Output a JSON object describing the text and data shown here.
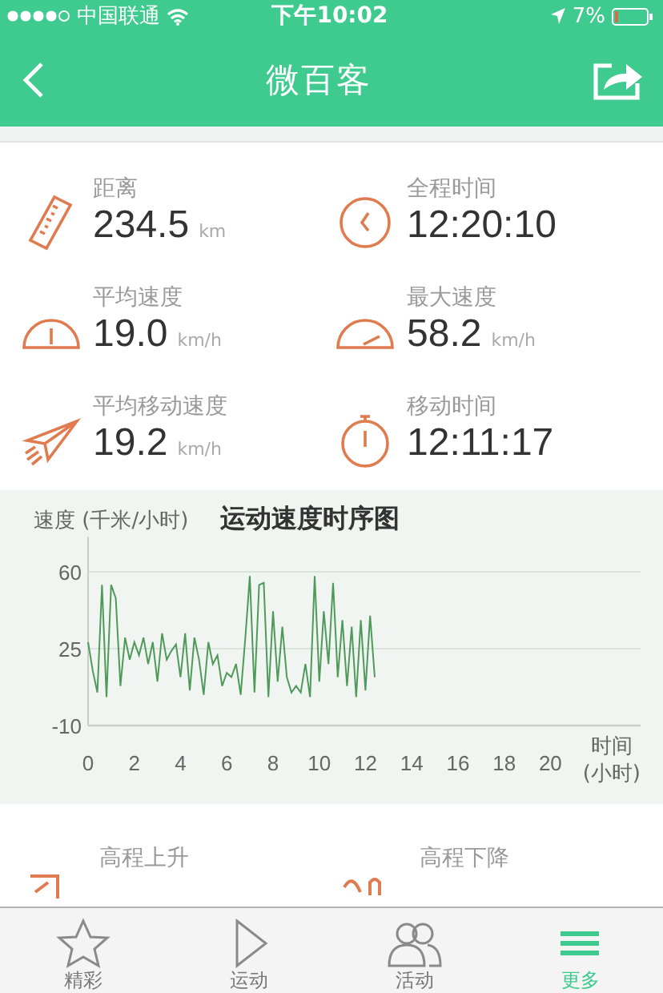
{
  "status_bar": {
    "carrier": "中国联通",
    "time": "下午10:02",
    "battery": "7%"
  },
  "nav": {
    "title": "微百客"
  },
  "stats": [
    {
      "kind": "ruler",
      "label": "距离",
      "value": "234.5",
      "unit": "km"
    },
    {
      "kind": "clock",
      "label": "全程时间",
      "value": "12:20:10"
    },
    {
      "kind": "gauge",
      "label": "平均速度",
      "value": "19.0",
      "unit": "km/h"
    },
    {
      "kind": "gauge-high",
      "label": "最大速度",
      "value": "58.2",
      "unit": "km/h"
    },
    {
      "kind": "plane",
      "label": "平均移动速度",
      "value": "19.2",
      "unit": "km/h"
    },
    {
      "kind": "stopwatch",
      "label": "移动时间",
      "value": "12:11:17"
    }
  ],
  "speed_chart": {
    "chart_data": {
      "type": "line",
      "title": "运动速度时序图",
      "ylabel": "速度 (千米/小时)",
      "xlabel": "时间\n(小时)",
      "xlim": [
        0,
        23.9
      ],
      "ylim": [
        -10,
        60
      ],
      "xticks": [
        0,
        2,
        4,
        6,
        8,
        10,
        12,
        14,
        16,
        18,
        20
      ],
      "yticks": [
        -10,
        25,
        60
      ],
      "x": [
        0,
        0.2,
        0.4,
        0.6,
        0.8,
        1,
        1.2,
        1.4,
        1.6,
        1.8,
        2,
        2.2,
        2.4,
        2.6,
        2.8,
        3,
        3.2,
        3.4,
        3.6,
        3.8,
        4,
        4.2,
        4.4,
        4.6,
        4.8,
        5,
        5.2,
        5.4,
        5.6,
        5.8,
        6,
        6.2,
        6.4,
        6.6,
        6.8,
        7,
        7.2,
        7.4,
        7.6,
        7.8,
        8,
        8.2,
        8.4,
        8.6,
        8.8,
        9,
        9.2,
        9.4,
        9.6,
        9.8,
        10,
        10.2,
        10.4,
        10.6,
        10.8,
        11,
        11.2,
        11.4,
        11.6,
        11.8,
        12,
        12.2,
        12.4
      ],
      "series": [
        {
          "color": "#4f9a5a",
          "values": [
            28,
            15,
            5,
            54,
            3,
            54,
            48,
            8,
            30,
            20,
            28,
            22,
            30,
            18,
            28,
            10,
            32,
            20,
            24,
            27,
            12,
            32,
            6,
            30,
            20,
            4,
            28,
            18,
            22,
            8,
            14,
            12,
            18,
            4,
            30,
            58,
            5,
            54,
            55,
            3,
            42,
            10,
            35,
            12,
            5,
            8,
            5,
            18,
            3,
            58,
            10,
            42,
            18,
            55,
            12,
            38,
            8,
            35,
            3,
            38,
            6,
            40,
            12
          ]
        }
      ]
    }
  },
  "elevation": [
    {
      "kind": "rise",
      "label": "高程上升"
    },
    {
      "kind": "fall",
      "label": "高程下降"
    }
  ],
  "tabs": [
    {
      "kind": "star",
      "label": "精彩",
      "selected": false
    },
    {
      "kind": "play",
      "label": "运动",
      "selected": false
    },
    {
      "kind": "people",
      "label": "活动",
      "selected": false
    },
    {
      "kind": "more",
      "label": "更多",
      "selected": true
    }
  ]
}
